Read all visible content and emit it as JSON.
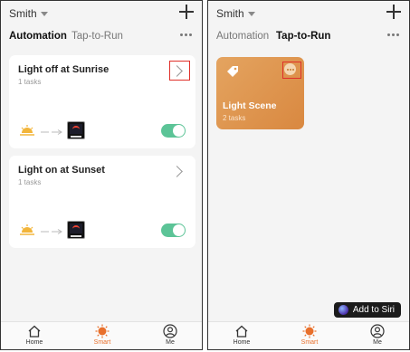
{
  "left": {
    "home_name": "Smith",
    "tabs": [
      {
        "label": "Automation",
        "active": true
      },
      {
        "label": "Tap-to-Run",
        "active": false
      }
    ],
    "cards": [
      {
        "title": "Light off at Sunrise",
        "subtitle": "1 tasks",
        "enabled": true,
        "highlighted_chevron": true
      },
      {
        "title": "Light on at Sunset",
        "subtitle": "1 tasks",
        "enabled": true,
        "highlighted_chevron": false
      }
    ],
    "nav": [
      {
        "label": "Home",
        "icon": "house-icon"
      },
      {
        "label": "Smart",
        "icon": "sun-icon",
        "active": true
      },
      {
        "label": "Me",
        "icon": "person-icon"
      }
    ]
  },
  "right": {
    "home_name": "Smith",
    "tabs": [
      {
        "label": "Automation",
        "active": false
      },
      {
        "label": "Tap-to-Run",
        "active": true
      }
    ],
    "scene": {
      "title": "Light Scene",
      "subtitle": "2 tasks",
      "color": "#e09a52"
    },
    "siri_label": "Add to Siri",
    "nav": [
      {
        "label": "Home",
        "icon": "house-icon"
      },
      {
        "label": "Smart",
        "icon": "sun-icon",
        "active": true
      },
      {
        "label": "Me",
        "icon": "person-icon"
      }
    ]
  },
  "colors": {
    "accent": "#e8702c",
    "toggle_on": "#5cc497",
    "highlight": "#e0302a"
  }
}
